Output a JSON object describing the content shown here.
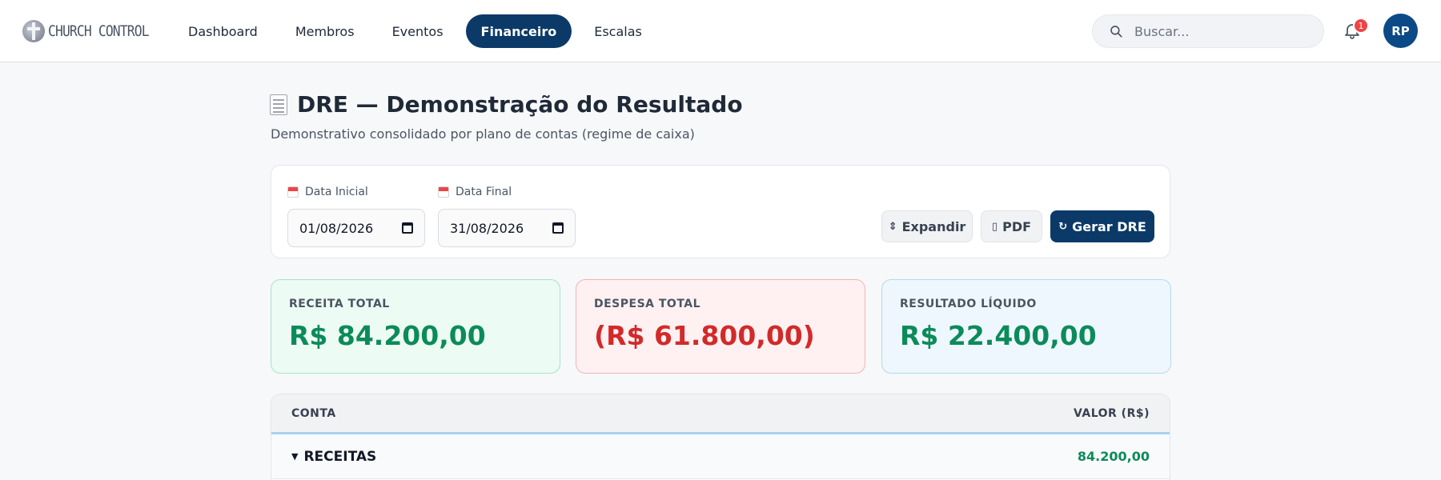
{
  "app": {
    "logo_text": "CHURCH CONTROL"
  },
  "nav": {
    "items": [
      {
        "label": "Dashboard"
      },
      {
        "label": "Membros"
      },
      {
        "label": "Eventos"
      },
      {
        "label": "Financeiro",
        "active": true
      },
      {
        "label": "Escalas"
      }
    ]
  },
  "search": {
    "placeholder": "Buscar..."
  },
  "notifications": {
    "count": "1"
  },
  "user": {
    "initials": "RP"
  },
  "page": {
    "title": "DRE — Demonstração do Resultado",
    "subtitle": "Demonstrativo consolidado por plano de contas (regime de caixa)"
  },
  "filters": {
    "start_label": "Data Inicial",
    "start_value": "01/08/2026",
    "end_label": "Data Final",
    "end_value": "31/08/2026"
  },
  "actions": {
    "expand_label": "Expandir",
    "pdf_label": "PDF",
    "generate_label": "Gerar DRE"
  },
  "summary": {
    "revenue_label": "RECEITA TOTAL",
    "revenue_value": "R$ 84.200,00",
    "expense_label": "DESPESA TOTAL",
    "expense_value": "(R$ 61.800,00)",
    "result_label": "RESULTADO LÍQUIDO",
    "result_value": "R$ 22.400,00"
  },
  "table": {
    "col_account": "CONTA",
    "col_value": "VALOR (R$)",
    "rows": [
      {
        "label": "RECEITAS",
        "value": "84.200,00"
      }
    ]
  },
  "colors": {
    "brand": "#0b3a68",
    "positive": "#0c8b5a",
    "negative": "#d22a2a",
    "badge": "#ef4444"
  }
}
